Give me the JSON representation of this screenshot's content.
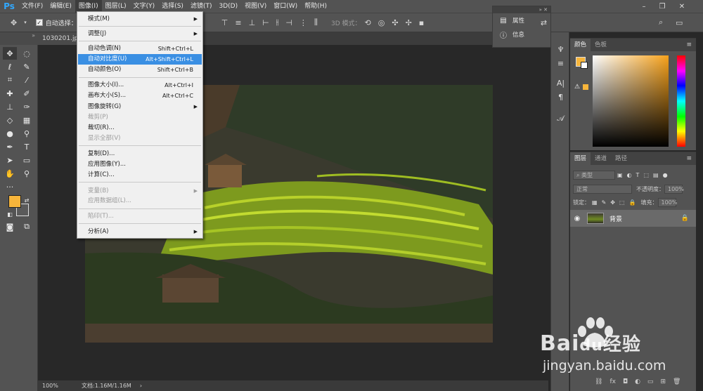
{
  "app": {
    "logo": "Ps"
  },
  "menubar": {
    "items": [
      "文件(F)",
      "编辑(E)",
      "图像(I)",
      "图层(L)",
      "文字(Y)",
      "选择(S)",
      "滤镜(T)",
      "3D(D)",
      "视图(V)",
      "窗口(W)",
      "帮助(H)"
    ],
    "active_index": 2
  },
  "options_bar": {
    "auto_select_label": "自动选择：",
    "mode_3d_label": "3D 模式："
  },
  "document": {
    "tab_title": "1030201.jpg",
    "zoom": "100%",
    "doc_size": "文档:1.16M/1.16M"
  },
  "image_menu": {
    "items": [
      {
        "label": "模式(M)",
        "shortcut": "",
        "submenu": true,
        "disabled": false
      },
      {
        "label": "调整(J)",
        "shortcut": "",
        "submenu": true,
        "disabled": false
      },
      {
        "label": "自动色调(N)",
        "shortcut": "Shift+Ctrl+L",
        "submenu": false,
        "disabled": false
      },
      {
        "label": "自动对比度(U)",
        "shortcut": "Alt+Shift+Ctrl+L",
        "submenu": false,
        "disabled": false,
        "highlighted": true
      },
      {
        "label": "自动颜色(O)",
        "shortcut": "Shift+Ctrl+B",
        "submenu": false,
        "disabled": false
      },
      {
        "label": "图像大小(I)...",
        "shortcut": "Alt+Ctrl+I",
        "submenu": false,
        "disabled": false
      },
      {
        "label": "画布大小(S)...",
        "shortcut": "Alt+Ctrl+C",
        "submenu": false,
        "disabled": false
      },
      {
        "label": "图像旋转(G)",
        "shortcut": "",
        "submenu": true,
        "disabled": false
      },
      {
        "label": "裁剪(P)",
        "shortcut": "",
        "submenu": false,
        "disabled": true
      },
      {
        "label": "裁切(R)...",
        "shortcut": "",
        "submenu": false,
        "disabled": false
      },
      {
        "label": "显示全部(V)",
        "shortcut": "",
        "submenu": false,
        "disabled": true
      },
      {
        "label": "复制(D)...",
        "shortcut": "",
        "submenu": false,
        "disabled": false
      },
      {
        "label": "应用图像(Y)...",
        "shortcut": "",
        "submenu": false,
        "disabled": false
      },
      {
        "label": "计算(C)...",
        "shortcut": "",
        "submenu": false,
        "disabled": false
      },
      {
        "label": "变量(B)",
        "shortcut": "",
        "submenu": true,
        "disabled": true
      },
      {
        "label": "应用数据组(L)...",
        "shortcut": "",
        "submenu": false,
        "disabled": true
      },
      {
        "label": "陷印(T)...",
        "shortcut": "",
        "submenu": false,
        "disabled": true
      },
      {
        "label": "分析(A)",
        "shortcut": "",
        "submenu": true,
        "disabled": false
      }
    ]
  },
  "float_panel": {
    "properties_label": "属性",
    "info_label": "信息"
  },
  "color_panel": {
    "tab_color": "颜色",
    "tab_swatches": "色板",
    "foreground_color": "#f7b53b"
  },
  "layers_panel": {
    "tabs": [
      "图层",
      "通道",
      "路径"
    ],
    "filter_kind": "类型",
    "blend_mode": "正常",
    "opacity_label": "不透明度：",
    "opacity_value": "100%",
    "lock_label": "锁定：",
    "fill_label": "填充：",
    "fill_value": "100%",
    "layer_name": "背景"
  },
  "watermark": {
    "brand": "Bai",
    "brand_mid": "du",
    "brand_cn": "经验",
    "url": "jingyan.baidu.com"
  }
}
